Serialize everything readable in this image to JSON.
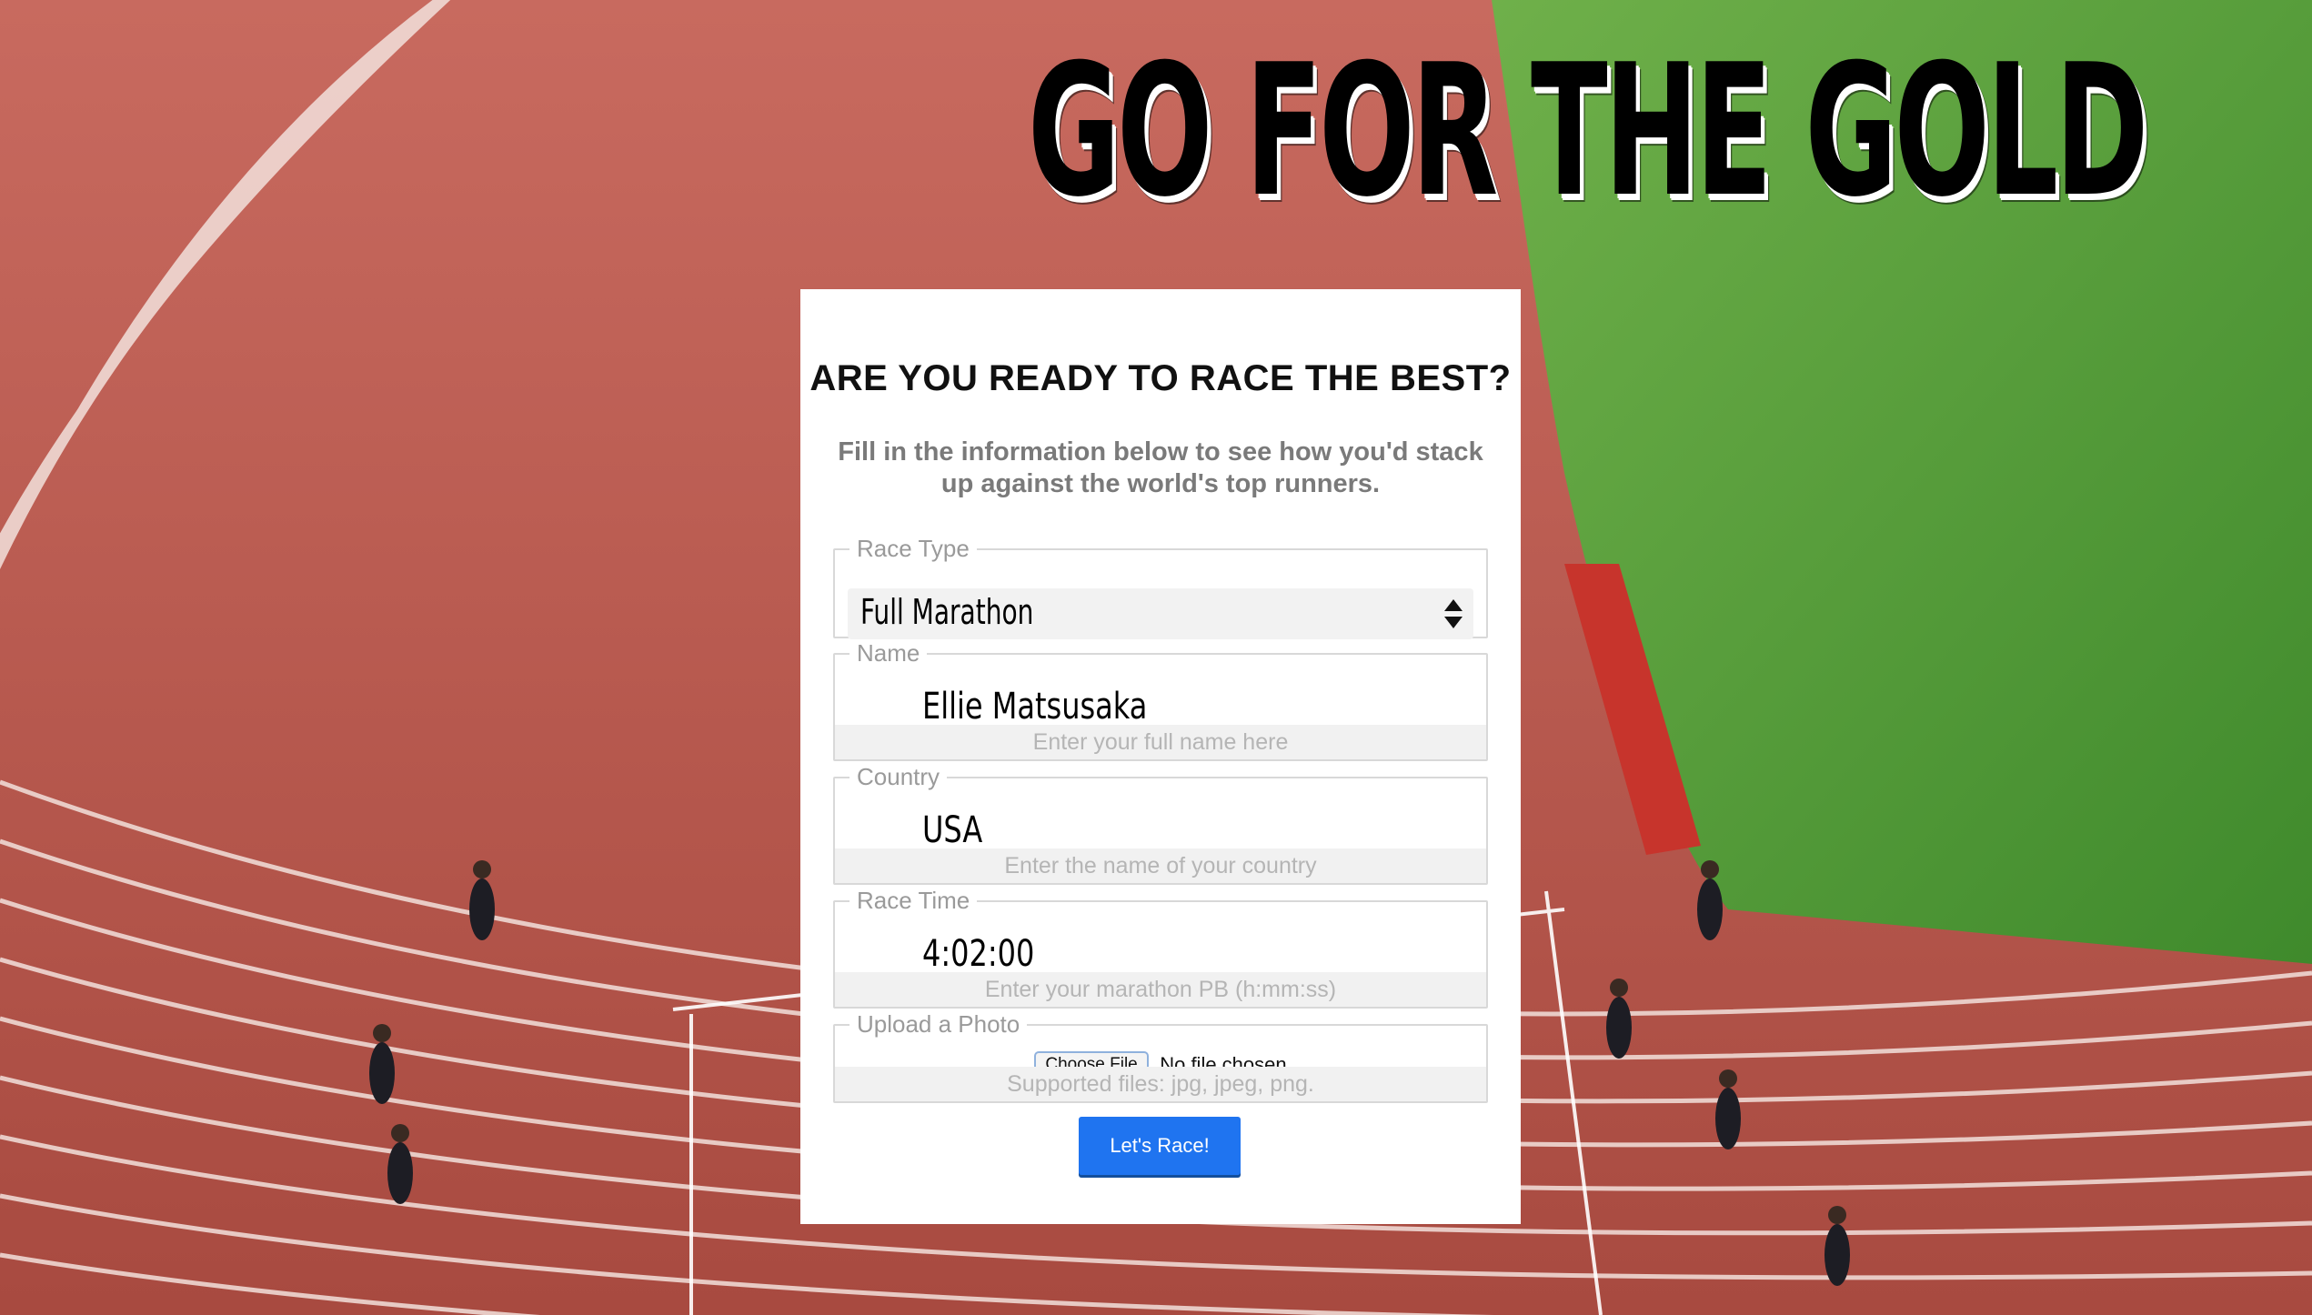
{
  "headline": "GO FOR THE GOLD",
  "card": {
    "title": "ARE YOU READY TO RACE THE BEST?",
    "subtitle": "Fill in the information below to see how you'd stack up against the world's top runners."
  },
  "fields": {
    "race_type": {
      "legend": "Race Type",
      "value": "Full Marathon"
    },
    "name": {
      "legend": "Name",
      "value": "Ellie Matsusaka",
      "placeholder": "Enter your full name here"
    },
    "country": {
      "legend": "Country",
      "value": "USA",
      "placeholder": "Enter the name of your country"
    },
    "race_time": {
      "legend": "Race Time",
      "value": "4:02:00",
      "placeholder": "Enter your marathon PB (h:mm:ss)"
    },
    "photo": {
      "legend": "Upload a Photo",
      "button": "Choose File",
      "status": "No file chosen",
      "hint": "Supported files: jpg, jpeg, png."
    }
  },
  "submit_label": "Let's Race!",
  "colors": {
    "track": "#b8544a",
    "grass": "#4f9a36",
    "button": "#1f74f0"
  },
  "background_scene": "running-track-with-runners"
}
